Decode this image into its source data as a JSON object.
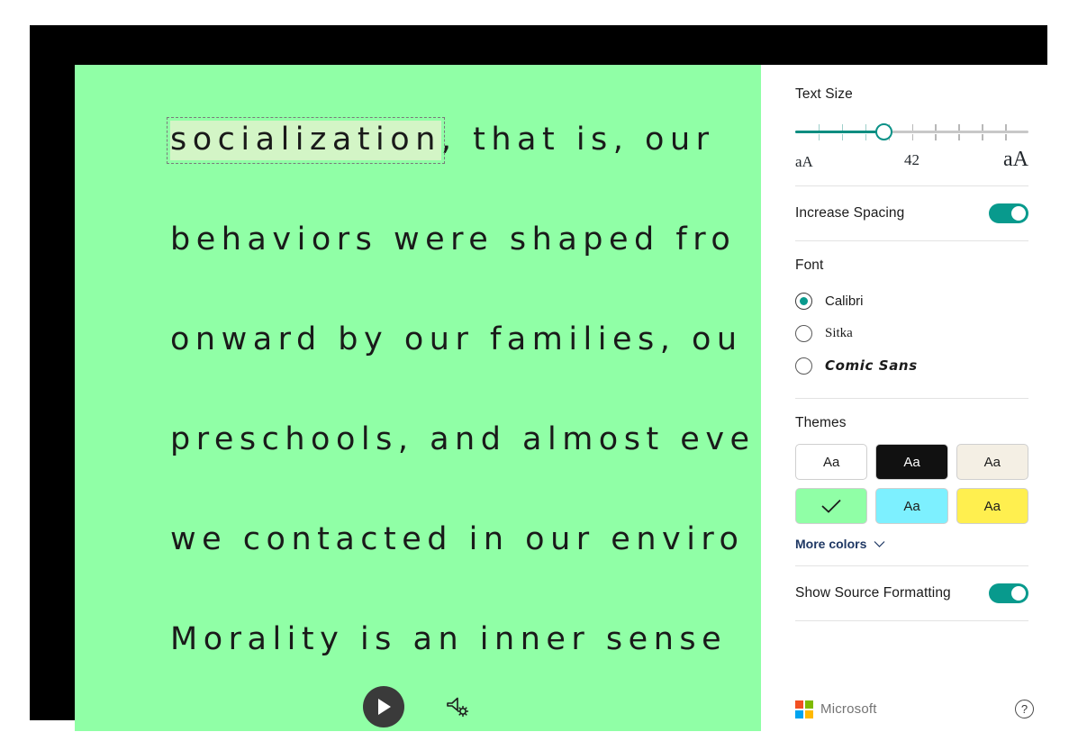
{
  "window": {
    "background_color": "#90ffa6",
    "frame_color": "#000000"
  },
  "reading_pane": {
    "lines": [
      {
        "highlight": "socialization",
        "rest": ", that is, our"
      },
      {
        "highlight": "",
        "rest": "behaviors were shaped fro"
      },
      {
        "highlight": "",
        "rest": "onward by our families, ou"
      },
      {
        "highlight": "",
        "rest": "preschools, and almost eve"
      },
      {
        "highlight": "",
        "rest": "we contacted in our enviro"
      },
      {
        "highlight": "",
        "rest": "Morality is an inner sense"
      }
    ],
    "highlight_color": "#d3f5c6",
    "text_color": "#1a1a1a",
    "play_label": "play-icon",
    "voice_settings_label": "voice-settings-icon"
  },
  "settings": {
    "text_size": {
      "title": "Text Size",
      "value": "42",
      "small_label": "aA",
      "large_label": "aA",
      "percent": 38,
      "tick_count": 9
    },
    "increase_spacing": {
      "label": "Increase Spacing",
      "state": "on"
    },
    "font": {
      "title": "Font",
      "options": [
        {
          "label": "Calibri",
          "selected": true
        },
        {
          "label": "Sitka",
          "selected": false
        },
        {
          "label": "Comic Sans",
          "selected": false
        }
      ]
    },
    "themes": {
      "title": "Themes",
      "swatches": [
        {
          "name": "white",
          "bg": "#ffffff",
          "fg": "#1b1b1b",
          "label": "Aa",
          "selected": false
        },
        {
          "name": "black",
          "bg": "#111111",
          "fg": "#ffffff",
          "label": "Aa",
          "selected": false
        },
        {
          "name": "sepia",
          "bg": "#f4efe4",
          "fg": "#1b1b1b",
          "label": "Aa",
          "selected": false
        },
        {
          "name": "green",
          "bg": "#90ffa6",
          "fg": "#1b1b1b",
          "label": "",
          "selected": true
        },
        {
          "name": "cyan",
          "bg": "#7df0ff",
          "fg": "#1b1b1b",
          "label": "Aa",
          "selected": false
        },
        {
          "name": "yellow",
          "bg": "#ffef4f",
          "fg": "#1b1b1b",
          "label": "Aa",
          "selected": false
        }
      ],
      "more_colors_label": "More colors"
    },
    "show_source_formatting": {
      "label": "Show Source Formatting",
      "state": "on"
    },
    "footer": {
      "brand": "Microsoft",
      "help_label": "?"
    },
    "accent_color": "#089a8d"
  }
}
